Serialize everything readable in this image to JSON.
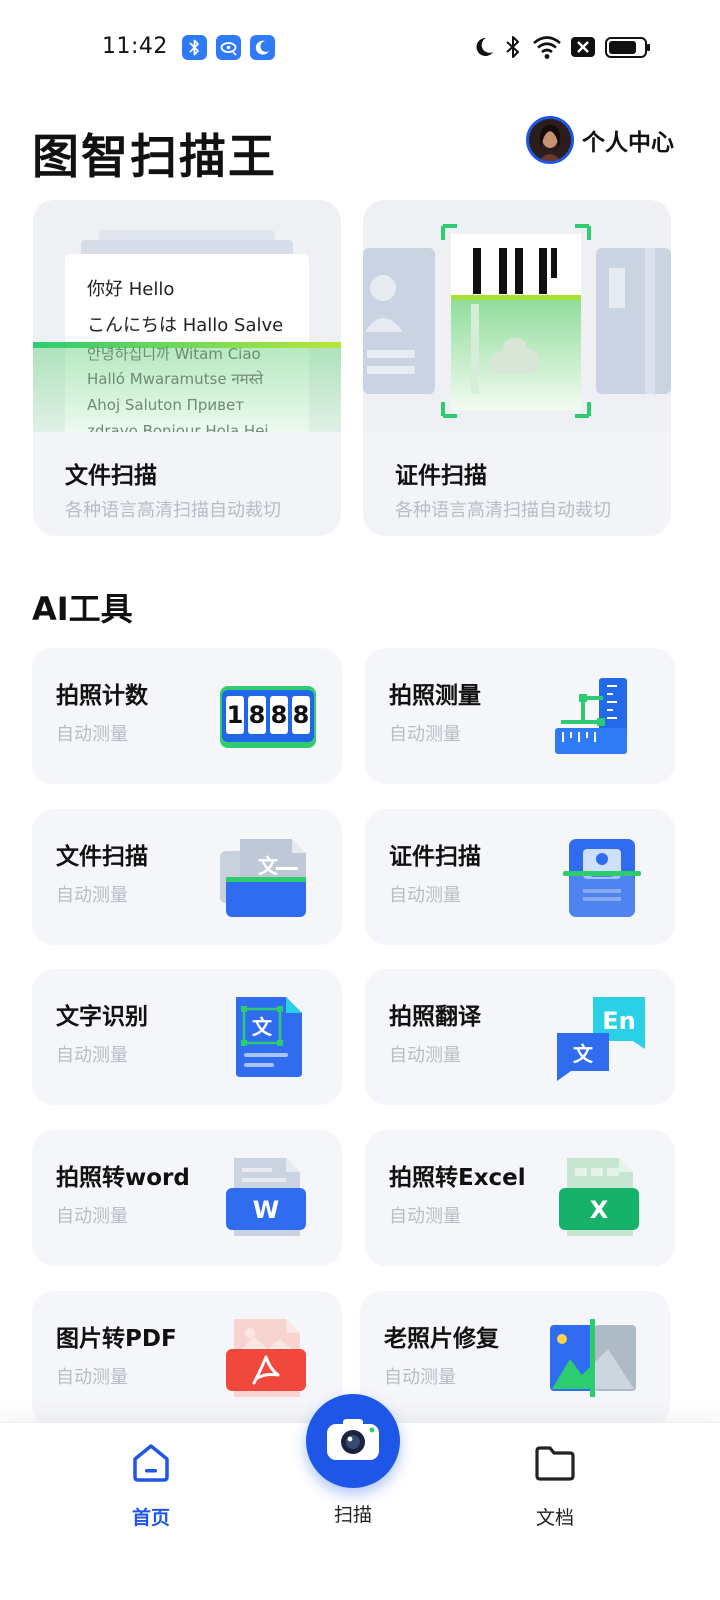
{
  "status_bar": {
    "time": "11:42",
    "left_icons": [
      "bluetooth-icon",
      "eye-care-icon",
      "moon-icon"
    ],
    "right_icons": [
      "moon-icon",
      "bluetooth-icon",
      "wifi-icon",
      "sim-off-icon",
      "battery-icon"
    ]
  },
  "header": {
    "title": "图智扫描王",
    "profile_label": "个人中心"
  },
  "scan_cards": [
    {
      "title": "文件扫描",
      "subtitle": "各种语言高清扫描自动裁切",
      "sample_lines": [
        "你好 Hello",
        "こんにちは Hallo Salve",
        "안녕하십니까 Witam Ciao",
        "Halló Mwaramutse नमस्ते",
        "Ahoj Saluton Привет",
        "zdravo Bonjour Hola Hej"
      ]
    },
    {
      "title": "证件扫描",
      "subtitle": "各种语言高清扫描自动裁切"
    }
  ],
  "ai_tools": {
    "section_title": "AI工具",
    "counter_digits": [
      "1",
      "8",
      "8",
      "8"
    ],
    "badge_wen": "文",
    "badge_en": "En",
    "badge_w": "W",
    "badge_x": "X",
    "items": [
      {
        "title": "拍照计数",
        "subtitle": "自动测量",
        "icon": "counter-icon"
      },
      {
        "title": "拍照测量",
        "subtitle": "自动测量",
        "icon": "ruler-icon"
      },
      {
        "title": "文件扫描",
        "subtitle": "自动测量",
        "icon": "document-scan-icon"
      },
      {
        "title": "证件扫描",
        "subtitle": "自动测量",
        "icon": "id-card-icon"
      },
      {
        "title": "文字识别",
        "subtitle": "自动测量",
        "icon": "text-recognition-icon"
      },
      {
        "title": "拍照翻译",
        "subtitle": "自动测量",
        "icon": "translate-icon"
      },
      {
        "title": "拍照转word",
        "subtitle": "自动测量",
        "icon": "word-icon"
      },
      {
        "title": "拍照转Excel",
        "subtitle": "自动测量",
        "icon": "excel-icon"
      },
      {
        "title": "图片转PDF",
        "subtitle": "自动测量",
        "icon": "pdf-icon"
      },
      {
        "title": "老照片修复",
        "subtitle": "自动测量",
        "icon": "photo-restore-icon"
      }
    ]
  },
  "bottom_nav": {
    "items": [
      {
        "label": "首页",
        "icon": "home-icon",
        "active": true
      },
      {
        "label": "扫描",
        "icon": "camera-icon",
        "active": false
      },
      {
        "label": "文档",
        "icon": "folder-icon",
        "active": false
      }
    ]
  },
  "colors": {
    "accent": "#1e56e8",
    "card_bg": "#f5f6f9",
    "scan_green": "#2ecc71"
  }
}
